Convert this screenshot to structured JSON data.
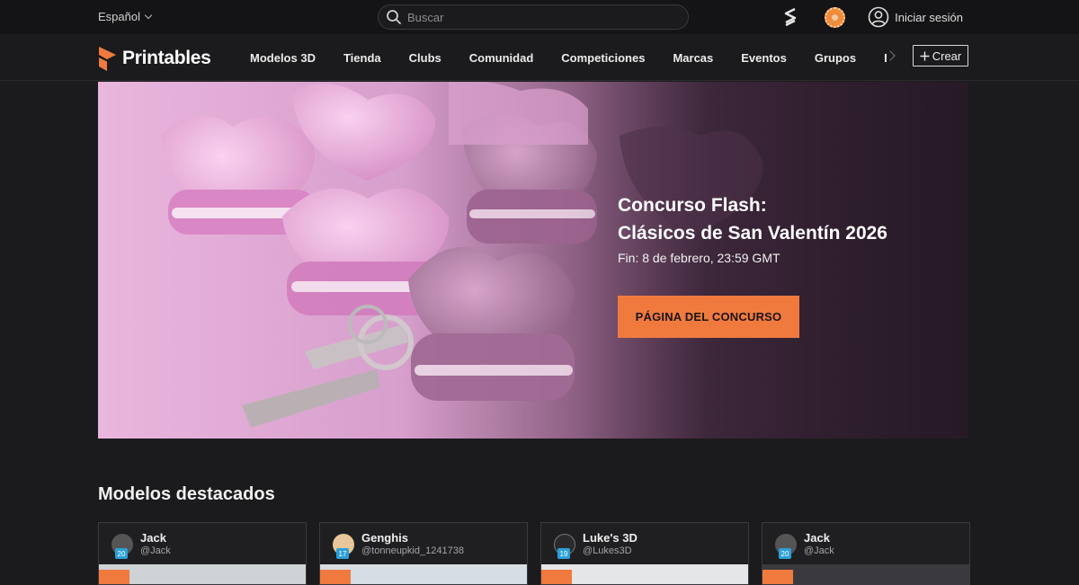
{
  "topbar": {
    "language": "Español",
    "search_placeholder": "Buscar",
    "login_label": "Iniciar sesión"
  },
  "navbar": {
    "logo_text": "Printables",
    "items": [
      "Modelos 3D",
      "Tienda",
      "Clubs",
      "Comunidad",
      "Competiciones",
      "Marcas",
      "Eventos",
      "Grupos",
      "Ed"
    ],
    "create_label": "Crear"
  },
  "hero": {
    "title_line1": "Concurso Flash:",
    "title_line2": "Clásicos de San Valentín 2026",
    "subtitle": "Fin: 8 de febrero, 23:59 GMT",
    "button_label": "PÁGINA DEL CONCURSO"
  },
  "featured": {
    "title": "Modelos destacados",
    "cards": [
      {
        "name": "Jack",
        "handle": "@Jack",
        "level": "20"
      },
      {
        "name": "Genghis",
        "handle": "@tonneupkid_1241738",
        "level": "17"
      },
      {
        "name": "Luke's 3D",
        "handle": "@Lukes3D",
        "level": "19"
      },
      {
        "name": "Jack",
        "handle": "@Jack",
        "level": "20"
      }
    ]
  },
  "colors": {
    "accent": "#f07a3e",
    "background": "#1b1b1d",
    "level_badge": "#2aa0d8"
  }
}
